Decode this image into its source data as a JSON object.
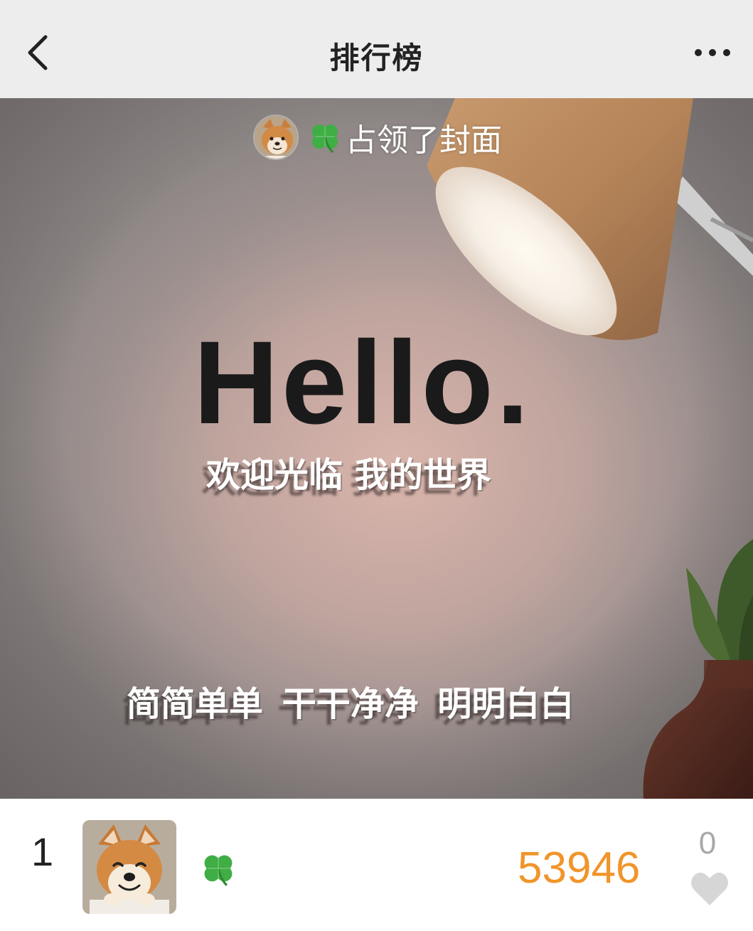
{
  "header": {
    "title": "排行榜",
    "back_icon": "chevron-left-icon",
    "more_icon": "more-horizontal-icon"
  },
  "cover": {
    "occupier_text": "占领了封面",
    "headline": "Hello.",
    "line1": "欢迎光临 我的世界",
    "line2": "简简单单 干干净净 明明白白"
  },
  "ranking": [
    {
      "rank": "1",
      "name_icon": "🍀",
      "steps": "53946",
      "likes": "0"
    }
  ],
  "colors": {
    "header_bg": "#ededed",
    "steps": "#f1952a",
    "likes": "#a8a8a8"
  }
}
